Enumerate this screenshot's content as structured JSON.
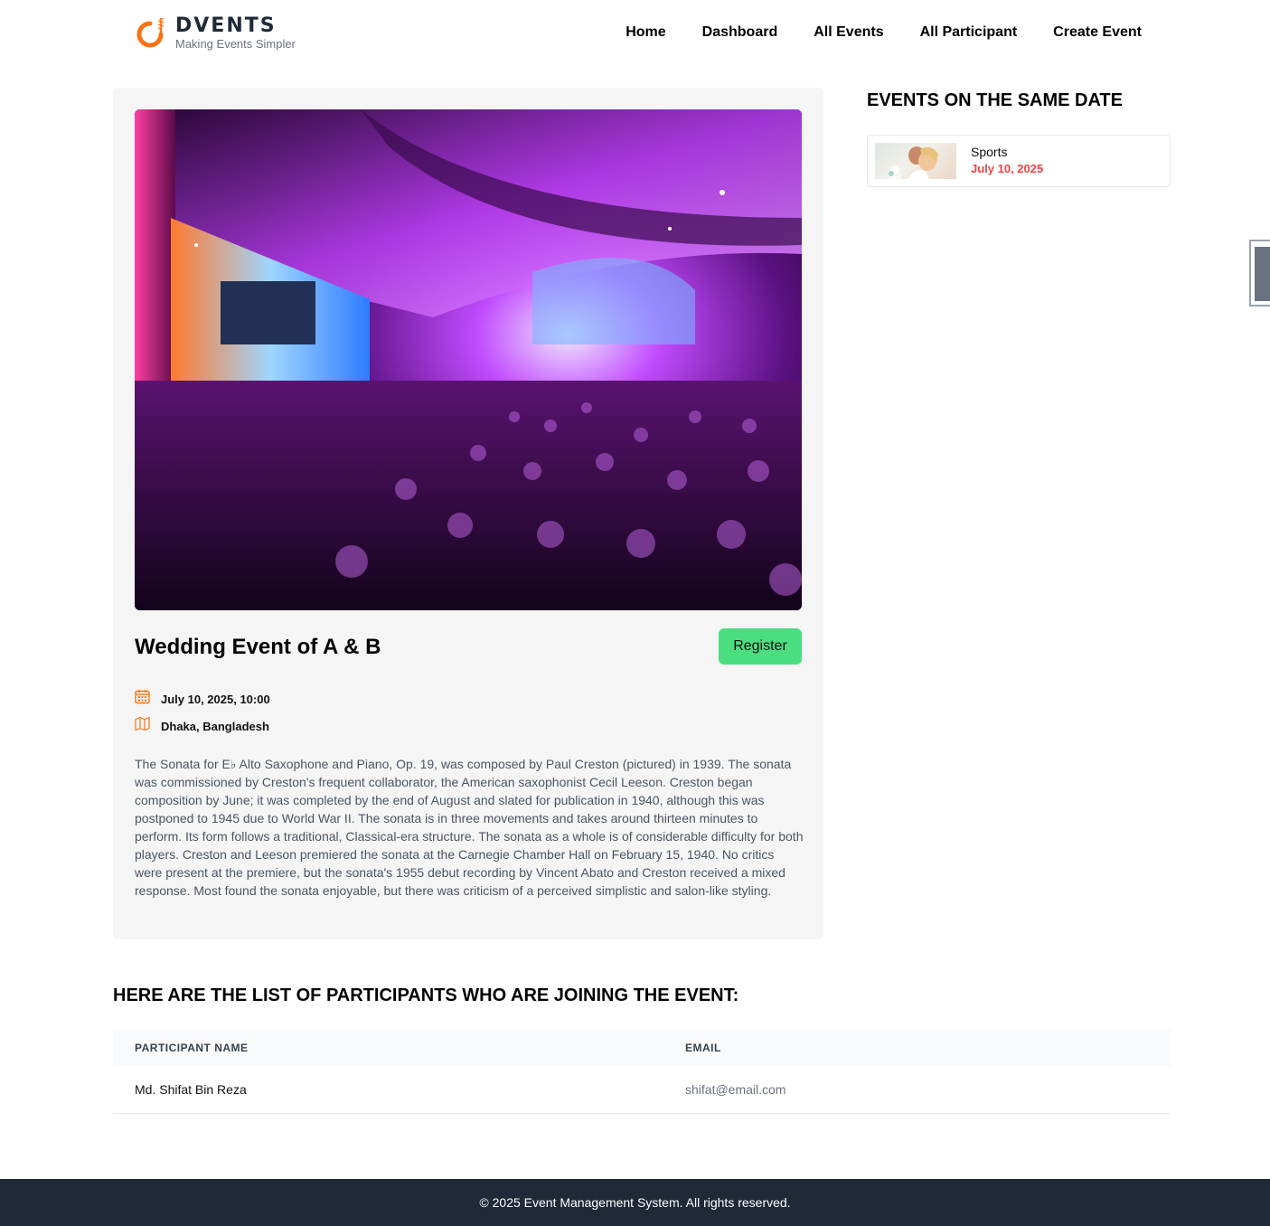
{
  "brand": {
    "name": "DVENTS",
    "tagline": "Making Events Simpler",
    "accent": "#f97316"
  },
  "nav": {
    "items": [
      {
        "label": "Home"
      },
      {
        "label": "Dashboard"
      },
      {
        "label": "All Events"
      },
      {
        "label": "All Participant"
      },
      {
        "label": "Create Event"
      }
    ]
  },
  "event": {
    "title": "Wedding Event of A & B",
    "register_label": "Register",
    "datetime": "July 10, 2025, 10:00",
    "location": "Dhaka, Bangladesh",
    "description": "The Sonata for E♭ Alto Saxophone and Piano, Op. 19, was composed by Paul Creston (pictured) in 1939. The sonata was commissioned by Creston's frequent collaborator, the American saxophonist Cecil Leeson. Creston began composition by June; it was completed by the end of August and slated for publication in 1940, although this was postponed to 1945 due to World War II. The sonata is in three movements and takes around thirteen minutes to perform. Its form follows a traditional, Classical-era structure. The sonata as a whole is of considerable difficulty for both players. Creston and Leeson premiered the sonata at the Carnegie Chamber Hall on February 15, 1940. No critics were present at the premiere, but the sonata's 1955 debut recording by Vincent Abato and Creston received a mixed response. Most found the sonata enjoyable, but there was criticism of a perceived simplistic and salon-like styling."
  },
  "sidebar": {
    "title": "EVENTS ON THE SAME DATE",
    "items": [
      {
        "name": "Sports",
        "date": "July 10, 2025"
      }
    ]
  },
  "participants": {
    "title": "HERE ARE THE LIST OF PARTICIPANTS WHO ARE JOINING THE EVENT:",
    "columns": [
      "PARTICIPANT NAME",
      "EMAIL"
    ],
    "rows": [
      {
        "name": "Md. Shifat Bin Reza",
        "email": "shifat@email.com"
      }
    ]
  },
  "footer": {
    "text": "© 2025 Event Management System. All rights reserved."
  },
  "colors": {
    "register": "#4ade80",
    "date_accent": "#ef4444",
    "footer_bg": "#1f2937"
  }
}
